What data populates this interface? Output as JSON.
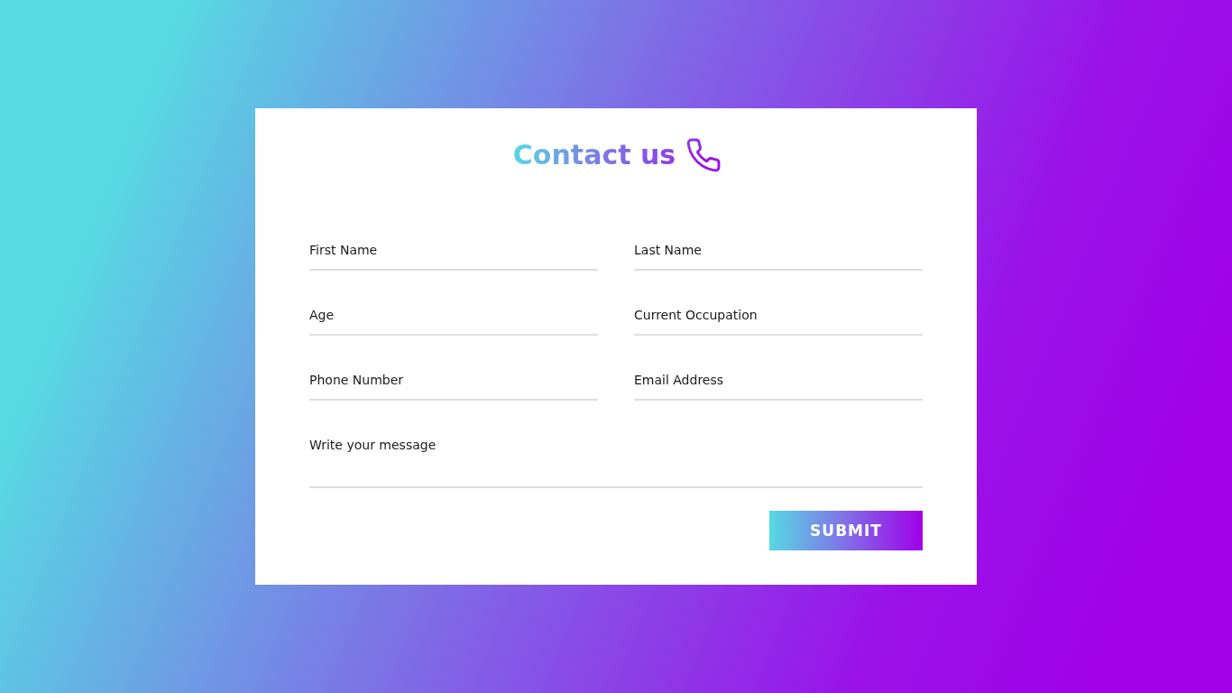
{
  "card": {
    "title": "Contact us"
  },
  "fields": [
    {
      "kind": "input",
      "placeholder": "First Name"
    },
    {
      "kind": "input",
      "placeholder": "Last Name"
    },
    {
      "kind": "input",
      "placeholder": "Age"
    },
    {
      "kind": "input",
      "placeholder": "Current Occupation"
    },
    {
      "kind": "input",
      "placeholder": "Phone Number"
    },
    {
      "kind": "input",
      "placeholder": "Email Address"
    },
    {
      "kind": "textarea",
      "placeholder": "Write your message"
    }
  ],
  "submit_button": {
    "label": "SUBMIT"
  }
}
